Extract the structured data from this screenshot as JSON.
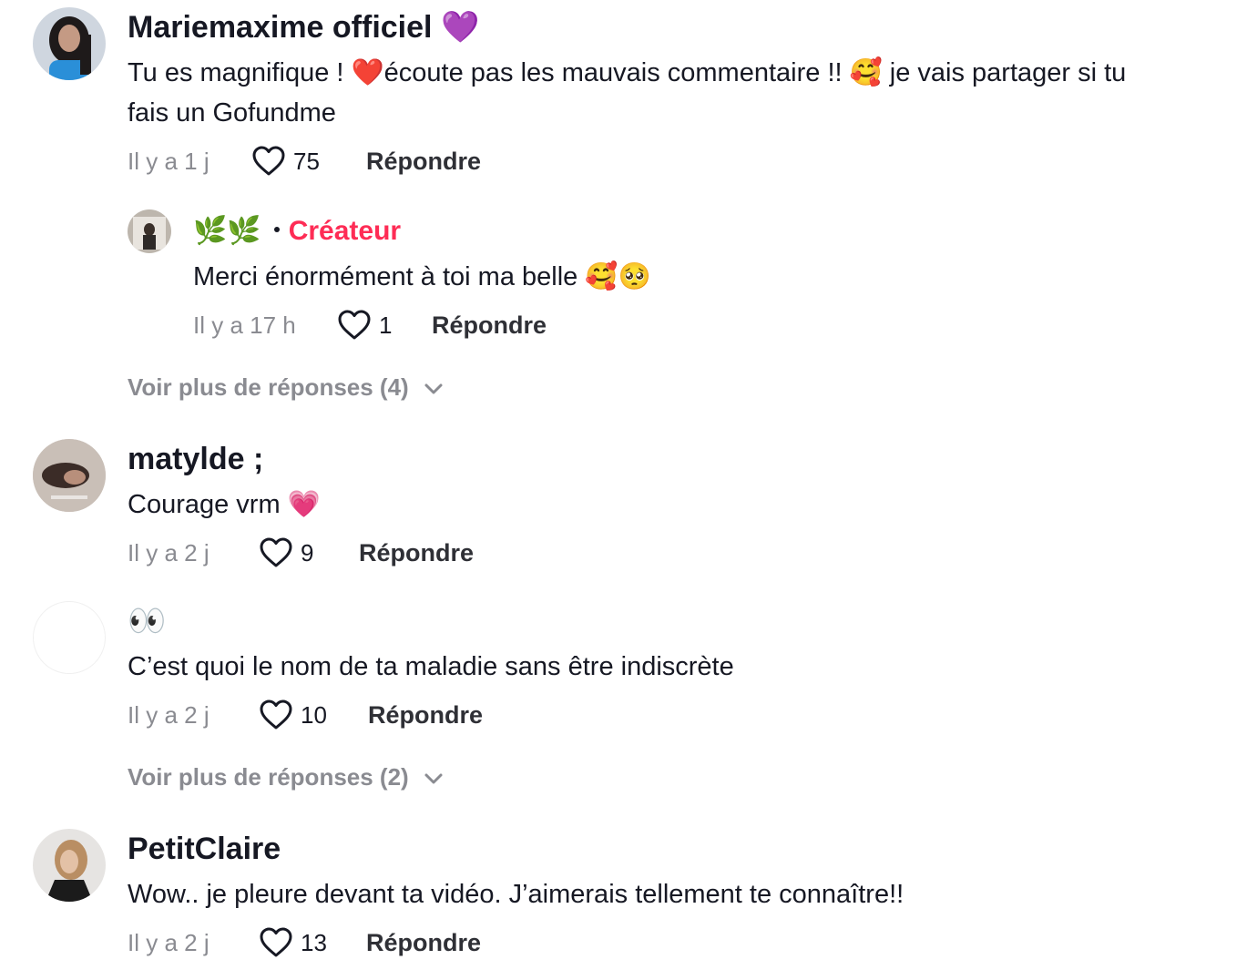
{
  "comments": [
    {
      "username": "Mariemaxime officiel",
      "badge_emoji": "💜",
      "text_line1": "Tu es magnifique ! ❤️écoute pas les mauvais commentaire !! 🥰 je vais partager si tu",
      "text_line2": "fais un Gofundme",
      "time": "Il y a 1 j",
      "likes": "75",
      "reply_label": "Répondre",
      "replies": [
        {
          "username_emoji": "🌿🌿",
          "creator_label": "Créateur",
          "text": "Merci énormément à toi ma belle 🥰🥺",
          "time": "Il y a 17 h",
          "likes": "1",
          "reply_label": "Répondre"
        }
      ],
      "more_replies": "Voir plus de réponses (4)"
    },
    {
      "username": "matylde ;",
      "text": "Courage vrm 💗",
      "time": "Il y a 2 j",
      "likes": "9",
      "reply_label": "Répondre"
    },
    {
      "username": "👀",
      "text": "C’est quoi le nom de ta maladie sans être indiscrète",
      "time": "Il y a 2 j",
      "likes": "10",
      "reply_label": "Répondre",
      "more_replies": "Voir plus de réponses (2)"
    },
    {
      "username": "PetitClaire",
      "text": "Wow.. je pleure devant ta vidéo. J’aimerais tellement te connaître!!",
      "time": "Il y a 2 j",
      "likes": "13",
      "reply_label": "Répondre"
    }
  ],
  "icons": {
    "like": "heart-outline-icon",
    "more": "chevron-down-icon"
  },
  "colors": {
    "creator": "#FE2C55",
    "muted": "#8a8b91",
    "text": "#161823"
  }
}
